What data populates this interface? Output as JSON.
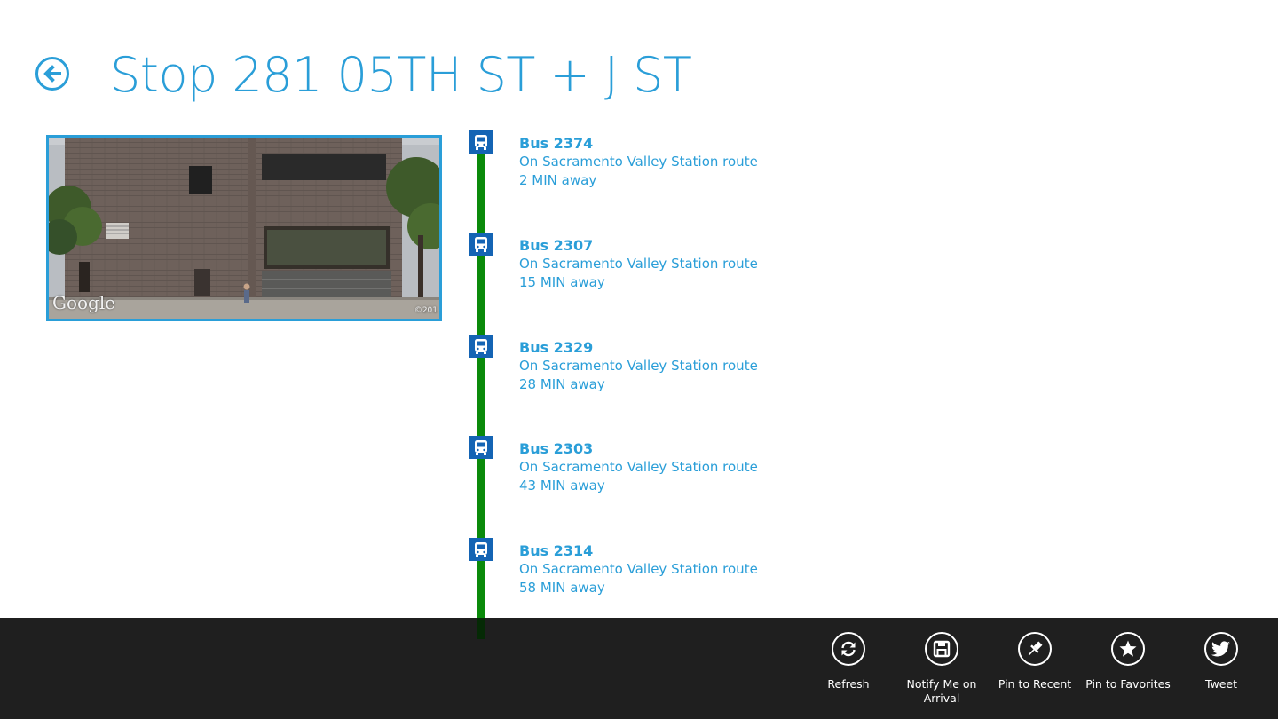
{
  "header": {
    "title": "Stop 281 05TH ST + J ST",
    "back_icon": "back-arrow-icon"
  },
  "photo": {
    "logo_text": "Google",
    "copyright_text": "©201"
  },
  "colors": {
    "accent": "#2a9ed8",
    "timeline": "#0a8a0a",
    "marker": "#1464b4",
    "app_bar": "#1f1f1f"
  },
  "arrivals": [
    {
      "bus": "Bus 2374",
      "route": "On Sacramento Valley Station route",
      "eta": "2 MIN away",
      "icon": "bus-icon"
    },
    {
      "bus": "Bus 2307",
      "route": "On Sacramento Valley Station route",
      "eta": "15 MIN away",
      "icon": "bus-icon"
    },
    {
      "bus": "Bus 2329",
      "route": "On Sacramento Valley Station route",
      "eta": "28 MIN away",
      "icon": "bus-icon"
    },
    {
      "bus": "Bus 2303",
      "route": "On Sacramento Valley Station route",
      "eta": "43 MIN away",
      "icon": "bus-icon"
    },
    {
      "bus": "Bus 2314",
      "route": "On Sacramento Valley Station route",
      "eta": "58 MIN away",
      "icon": "bus-icon"
    }
  ],
  "app_bar": {
    "buttons": [
      {
        "label": "Refresh",
        "icon": "refresh-icon"
      },
      {
        "label": "Notify Me on Arrival",
        "icon": "save-icon"
      },
      {
        "label": "Pin to Recent",
        "icon": "pin-icon"
      },
      {
        "label": "Pin to Favorites",
        "icon": "star-icon"
      },
      {
        "label": "Tweet",
        "icon": "twitter-icon"
      }
    ]
  }
}
